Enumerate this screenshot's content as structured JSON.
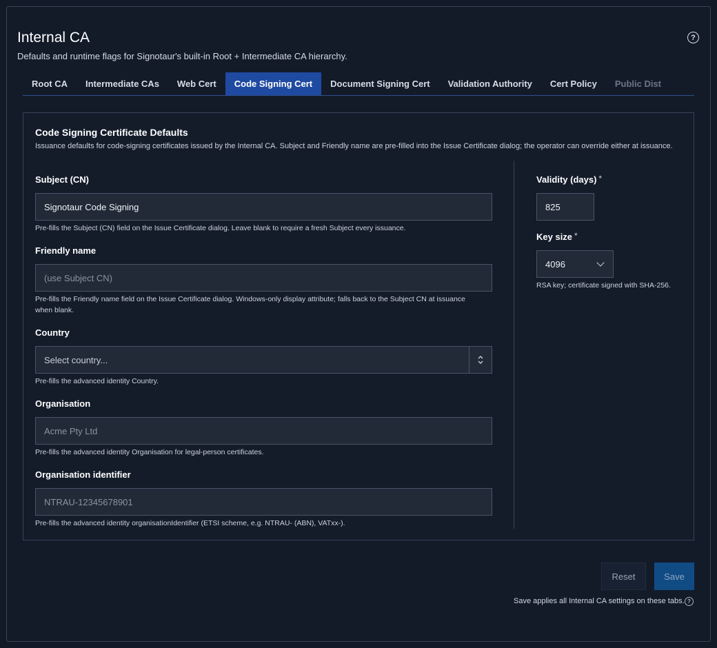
{
  "header": {
    "title": "Internal CA",
    "subtitle": "Defaults and runtime flags for Signotaur's built-in Root + Intermediate CA hierarchy.",
    "help_icon": "question-circle-icon"
  },
  "tabs": [
    {
      "label": "Root CA",
      "state": "normal"
    },
    {
      "label": "Intermediate CAs",
      "state": "normal"
    },
    {
      "label": "Web Cert",
      "state": "normal"
    },
    {
      "label": "Code Signing Cert",
      "state": "active"
    },
    {
      "label": "Document Signing Cert",
      "state": "normal"
    },
    {
      "label": "Validation Authority",
      "state": "normal"
    },
    {
      "label": "Cert Policy",
      "state": "normal"
    },
    {
      "label": "Public Dist",
      "state": "disabled"
    }
  ],
  "panel": {
    "title": "Code Signing Certificate Defaults",
    "description": "Issuance defaults for code-signing certificates issued by the Internal CA. Subject and Friendly name are pre-filled into the Issue Certificate dialog; the operator can override either at issuance."
  },
  "fields": {
    "subject": {
      "label": "Subject (CN)",
      "value": "Signotaur Code Signing",
      "help": "Pre-fills the Subject (CN) field on the Issue Certificate dialog. Leave blank to require a fresh Subject every issuance."
    },
    "friendly_name": {
      "label": "Friendly name",
      "placeholder": "(use Subject CN)",
      "help_line1": "Pre-fills the Friendly name field on the Issue Certificate dialog. Windows-only display attribute; falls back to the Subject CN at issuance",
      "help_line2": "when blank."
    },
    "country": {
      "label": "Country",
      "placeholder": "Select country...",
      "help": "Pre-fills the advanced identity Country."
    },
    "organisation": {
      "label": "Organisation",
      "placeholder": "Acme Pty Ltd",
      "help": "Pre-fills the advanced identity Organisation for legal-person certificates."
    },
    "org_identifier": {
      "label": "Organisation identifier",
      "placeholder": "NTRAU-12345678901",
      "help": "Pre-fills the advanced identity organisationIdentifier (ETSI scheme, e.g. NTRAU- (ABN), VATxx-)."
    },
    "validity": {
      "label": "Validity (days)",
      "required_mark": "*",
      "value": "825"
    },
    "key_size": {
      "label": "Key size",
      "required_mark": "*",
      "value": "4096",
      "help": "RSA key; certificate signed with SHA-256."
    }
  },
  "footer": {
    "reset_label": "Reset",
    "save_label": "Save",
    "note": "Save applies all Internal CA settings on these tabs."
  }
}
